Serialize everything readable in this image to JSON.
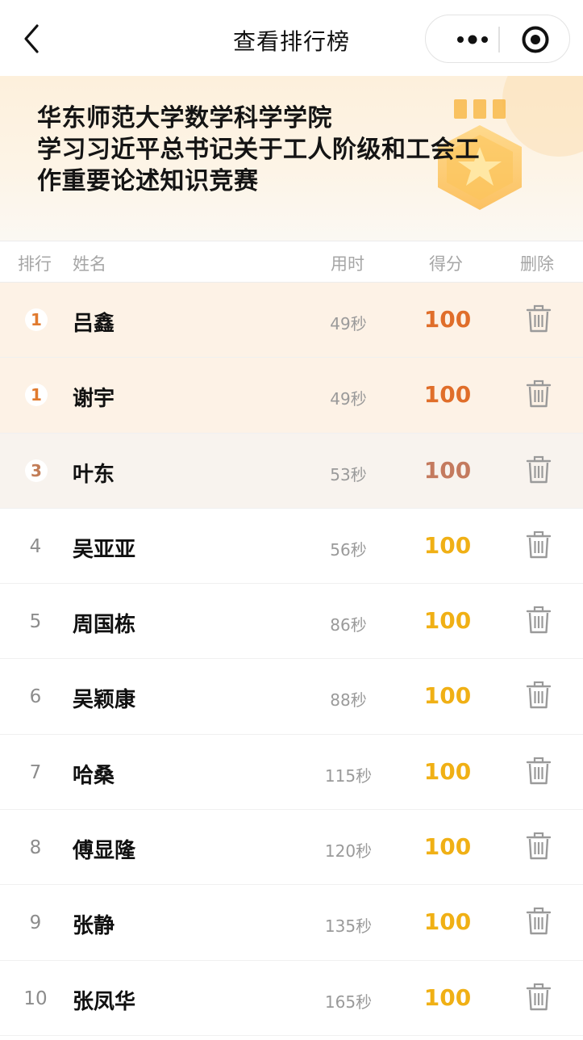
{
  "nav": {
    "title": "查看排行榜"
  },
  "banner": {
    "title_line1": "华东师范大学数学科学学院",
    "title_line2": "学习习近平总书记关于工人阶级和工会工",
    "title_line3": "作重要论述知识竞赛"
  },
  "table": {
    "headers": {
      "rank": "排行",
      "name": "姓名",
      "time": "用时",
      "score": "得分",
      "delete": "删除"
    },
    "rows": [
      {
        "rank": "1",
        "name": "吕鑫",
        "time": "49秒",
        "score": "100"
      },
      {
        "rank": "1",
        "name": "谢宇",
        "time": "49秒",
        "score": "100"
      },
      {
        "rank": "3",
        "name": "叶东",
        "time": "53秒",
        "score": "100"
      },
      {
        "rank": "4",
        "name": "吴亚亚",
        "time": "56秒",
        "score": "100"
      },
      {
        "rank": "5",
        "name": "周国栋",
        "time": "86秒",
        "score": "100"
      },
      {
        "rank": "6",
        "name": "吴颖康",
        "time": "88秒",
        "score": "100"
      },
      {
        "rank": "7",
        "name": "哈桑",
        "time": "115秒",
        "score": "100"
      },
      {
        "rank": "8",
        "name": "傅显隆",
        "time": "120秒",
        "score": "100"
      },
      {
        "rank": "9",
        "name": "张静",
        "time": "135秒",
        "score": "100"
      },
      {
        "rank": "10",
        "name": "张凤华",
        "time": "165秒",
        "score": "100"
      }
    ]
  },
  "colors": {
    "accent_gold": "#f0b015",
    "accent_orange": "#e06e2a",
    "accent_bronze": "#c47a5e",
    "banner_bg": "#fdf0dc"
  },
  "icons": {
    "back": "chevron-left-icon",
    "more": "more-dots-icon",
    "close": "target-circle-icon",
    "delete": "trash-icon",
    "medal": "medal-star-icon"
  }
}
